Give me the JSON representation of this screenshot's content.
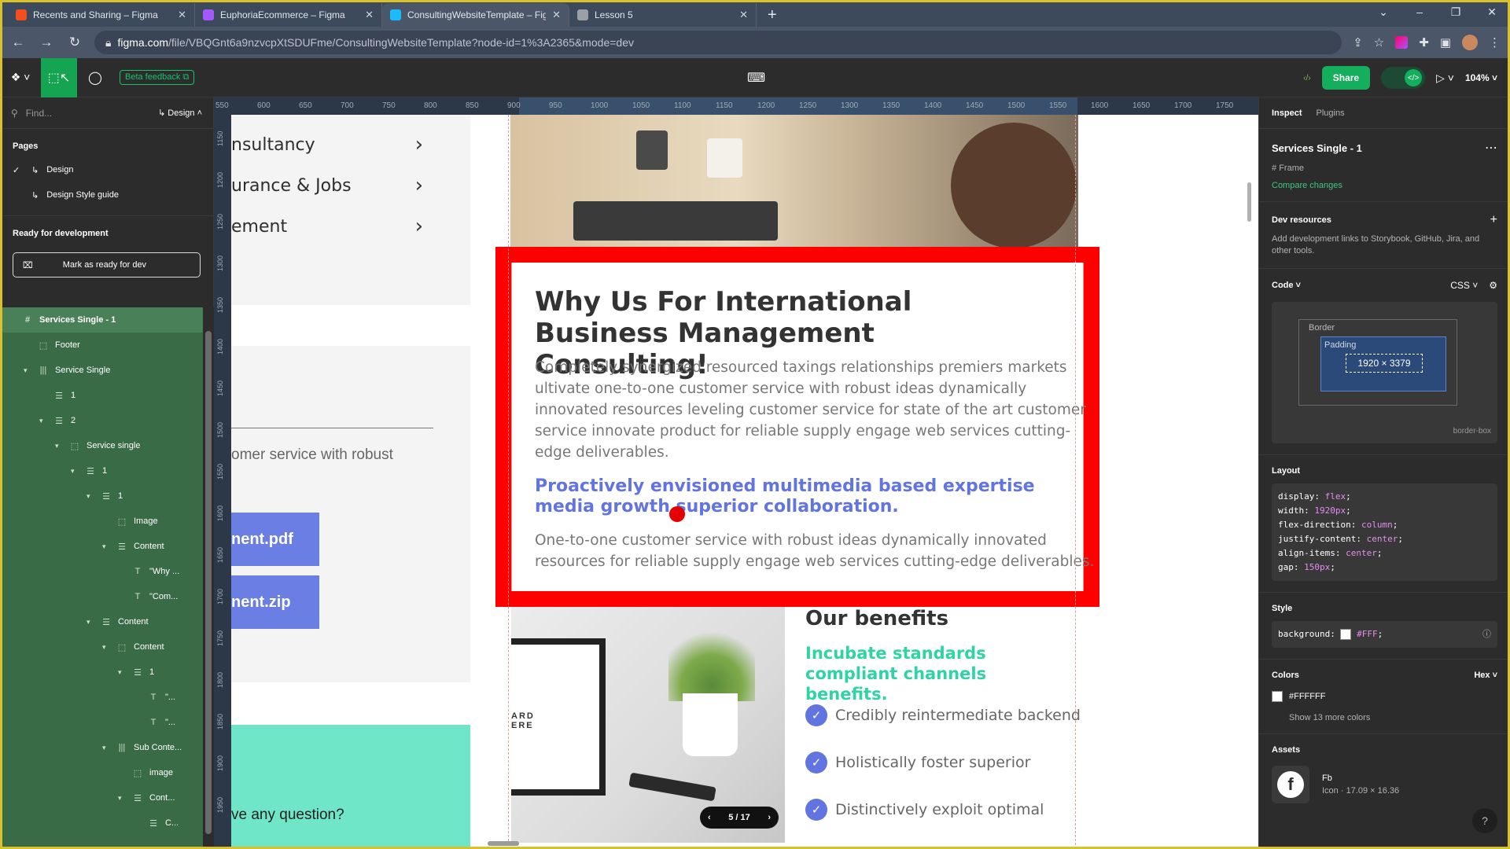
{
  "browser": {
    "tabs": [
      {
        "label": "Recents and Sharing – Figma",
        "color": "#f24e1e"
      },
      {
        "label": "EuphoriaEcommerce – Figma",
        "color": "#a259ff"
      },
      {
        "label": "ConsultingWebsiteTemplate – Fig",
        "color": "#1abcfe"
      },
      {
        "label": "Lesson 5",
        "color": "#9aa0a6"
      }
    ],
    "url_domain": "figma.com",
    "url_path": "/file/VBQGnt6a9nzvcpXtSDUFme/ConsultingWebsiteTemplate?node-id=1%3A2365&mode=dev"
  },
  "toolbar": {
    "beta_feedback": "Beta feedback",
    "share": "Share",
    "zoom": "104%"
  },
  "left_panel": {
    "search_placeholder": "Find...",
    "page_selector": "Design",
    "pages_heading": "Pages",
    "pages": [
      "Design",
      "Design Style guide"
    ],
    "ready_heading": "Ready for development",
    "ready_button": "Mark as ready for dev",
    "layers": [
      {
        "label": "Services Single - 1",
        "indent": 0,
        "icon": "#",
        "caret": "",
        "selected": true
      },
      {
        "label": "Footer",
        "indent": 1,
        "icon": "⬚",
        "caret": ""
      },
      {
        "label": "Service Single",
        "indent": 1,
        "icon": "|||",
        "caret": "▾"
      },
      {
        "label": "1",
        "indent": 2,
        "icon": "☰",
        "caret": ""
      },
      {
        "label": "2",
        "indent": 2,
        "icon": "☰",
        "caret": "▾"
      },
      {
        "label": "Service single",
        "indent": 3,
        "icon": "⬚",
        "caret": "▾"
      },
      {
        "label": "1",
        "indent": 4,
        "icon": "☰",
        "caret": "▾"
      },
      {
        "label": "1",
        "indent": 5,
        "icon": "☰",
        "caret": "▾"
      },
      {
        "label": "Image",
        "indent": 6,
        "icon": "⬚",
        "caret": ""
      },
      {
        "label": "Content",
        "indent": 6,
        "icon": "☰",
        "caret": "▾"
      },
      {
        "label": "\"Why ...",
        "indent": 7,
        "icon": "T",
        "caret": ""
      },
      {
        "label": "\"Com...",
        "indent": 7,
        "icon": "T",
        "caret": ""
      },
      {
        "label": "Content",
        "indent": 5,
        "icon": "☰",
        "caret": "▾"
      },
      {
        "label": "Content",
        "indent": 6,
        "icon": "⬚",
        "caret": "▾"
      },
      {
        "label": "1",
        "indent": 7,
        "icon": "☰",
        "caret": "▾"
      },
      {
        "label": "\"...",
        "indent": 8,
        "icon": "T",
        "caret": ""
      },
      {
        "label": "\"...",
        "indent": 8,
        "icon": "T",
        "caret": ""
      },
      {
        "label": "Sub Conte...",
        "indent": 6,
        "icon": "|||",
        "caret": "▾"
      },
      {
        "label": "image",
        "indent": 7,
        "icon": "⬚",
        "caret": ""
      },
      {
        "label": "Cont...",
        "indent": 7,
        "icon": "☰",
        "caret": "▾"
      },
      {
        "label": "C...",
        "indent": 8,
        "icon": "☰",
        "caret": ""
      }
    ]
  },
  "rulers": {
    "h_ticks": [
      "550",
      "600",
      "650",
      "700",
      "750",
      "800",
      "850",
      "900",
      "950",
      "1000",
      "1050",
      "1100",
      "1150",
      "1200",
      "1250",
      "1300",
      "1350",
      "1400",
      "1450",
      "1500",
      "1550",
      "1600",
      "1650",
      "1700",
      "1750"
    ],
    "v_ticks": [
      "1150",
      "1200",
      "1250",
      "1300",
      "1350",
      "1400",
      "1450",
      "1500",
      "1550",
      "1600",
      "1650",
      "1700",
      "1750",
      "1800",
      "1850",
      "1900",
      "1950"
    ]
  },
  "canvas": {
    "services": [
      "nsultancy",
      "urance & Jobs",
      "ement"
    ],
    "dl_text": "omer service with robust",
    "dl_buttons": [
      "nent.pdf",
      "nent.zip"
    ],
    "question": "ve any question?",
    "why_title": "Why Us For International Business Management Consulting!",
    "why_para": "Completely synergized resourced taxings relationships premiers markets ultivate one-to-one customer service with robust ideas dynamically innovated resources leveling customer service for state of the art  customer service innovate product for reliable supply engage web services cutting-edge deliverables.",
    "why_sub": "Proactively envisioned multimedia based expertise media growth superior collaboration.",
    "why_para2": "One-to-one customer service with robust ideas dynamically innovated resources for reliable supply engage web services cutting-edge deliverables.",
    "laptop_text": "ARD\nERE",
    "slider_counter": "5 / 17",
    "benefits_title": "Our benefits",
    "benefits_sub": "Incubate standards compliant channels benefits.",
    "benefits": [
      "Credibly reintermediate backend",
      "Holistically foster superior",
      "Distinctively exploit optimal"
    ],
    "accent_blue": "#6274e0",
    "accent_teal": "#2fd3a6",
    "highlight_color": "#ff0000"
  },
  "right_panel": {
    "tabs": [
      "Inspect",
      "Plugins"
    ],
    "frame_name": "Services Single - 1",
    "frame_type": "Frame",
    "compare": "Compare changes",
    "dev_resources": "Dev resources",
    "dev_resources_desc": "Add development links to Storybook, GitHub, Jira, and other tools.",
    "code_heading": "Code",
    "code_lang": "CSS",
    "box_border": "Border",
    "box_padding": "Padding",
    "box_size": "1920 × 3379",
    "box_sizing": "border-box",
    "layout_heading": "Layout",
    "layout_css": [
      {
        "k": "display",
        "v": "flex"
      },
      {
        "k": "width",
        "v": "1920px"
      },
      {
        "k": "flex-direction",
        "v": "column"
      },
      {
        "k": "justify-content",
        "v": "center"
      },
      {
        "k": "align-items",
        "v": "center"
      },
      {
        "k": "gap",
        "v": "150px"
      }
    ],
    "style_heading": "Style",
    "style_key": "background",
    "style_value": "#FFF",
    "colors_heading": "Colors",
    "colors_format": "Hex",
    "color_value": "#FFFFFF",
    "more_colors": "Show 13 more colors",
    "assets_heading": "Assets",
    "asset_name": "Fb",
    "asset_meta": "Icon · 17.09 × 16.36"
  }
}
